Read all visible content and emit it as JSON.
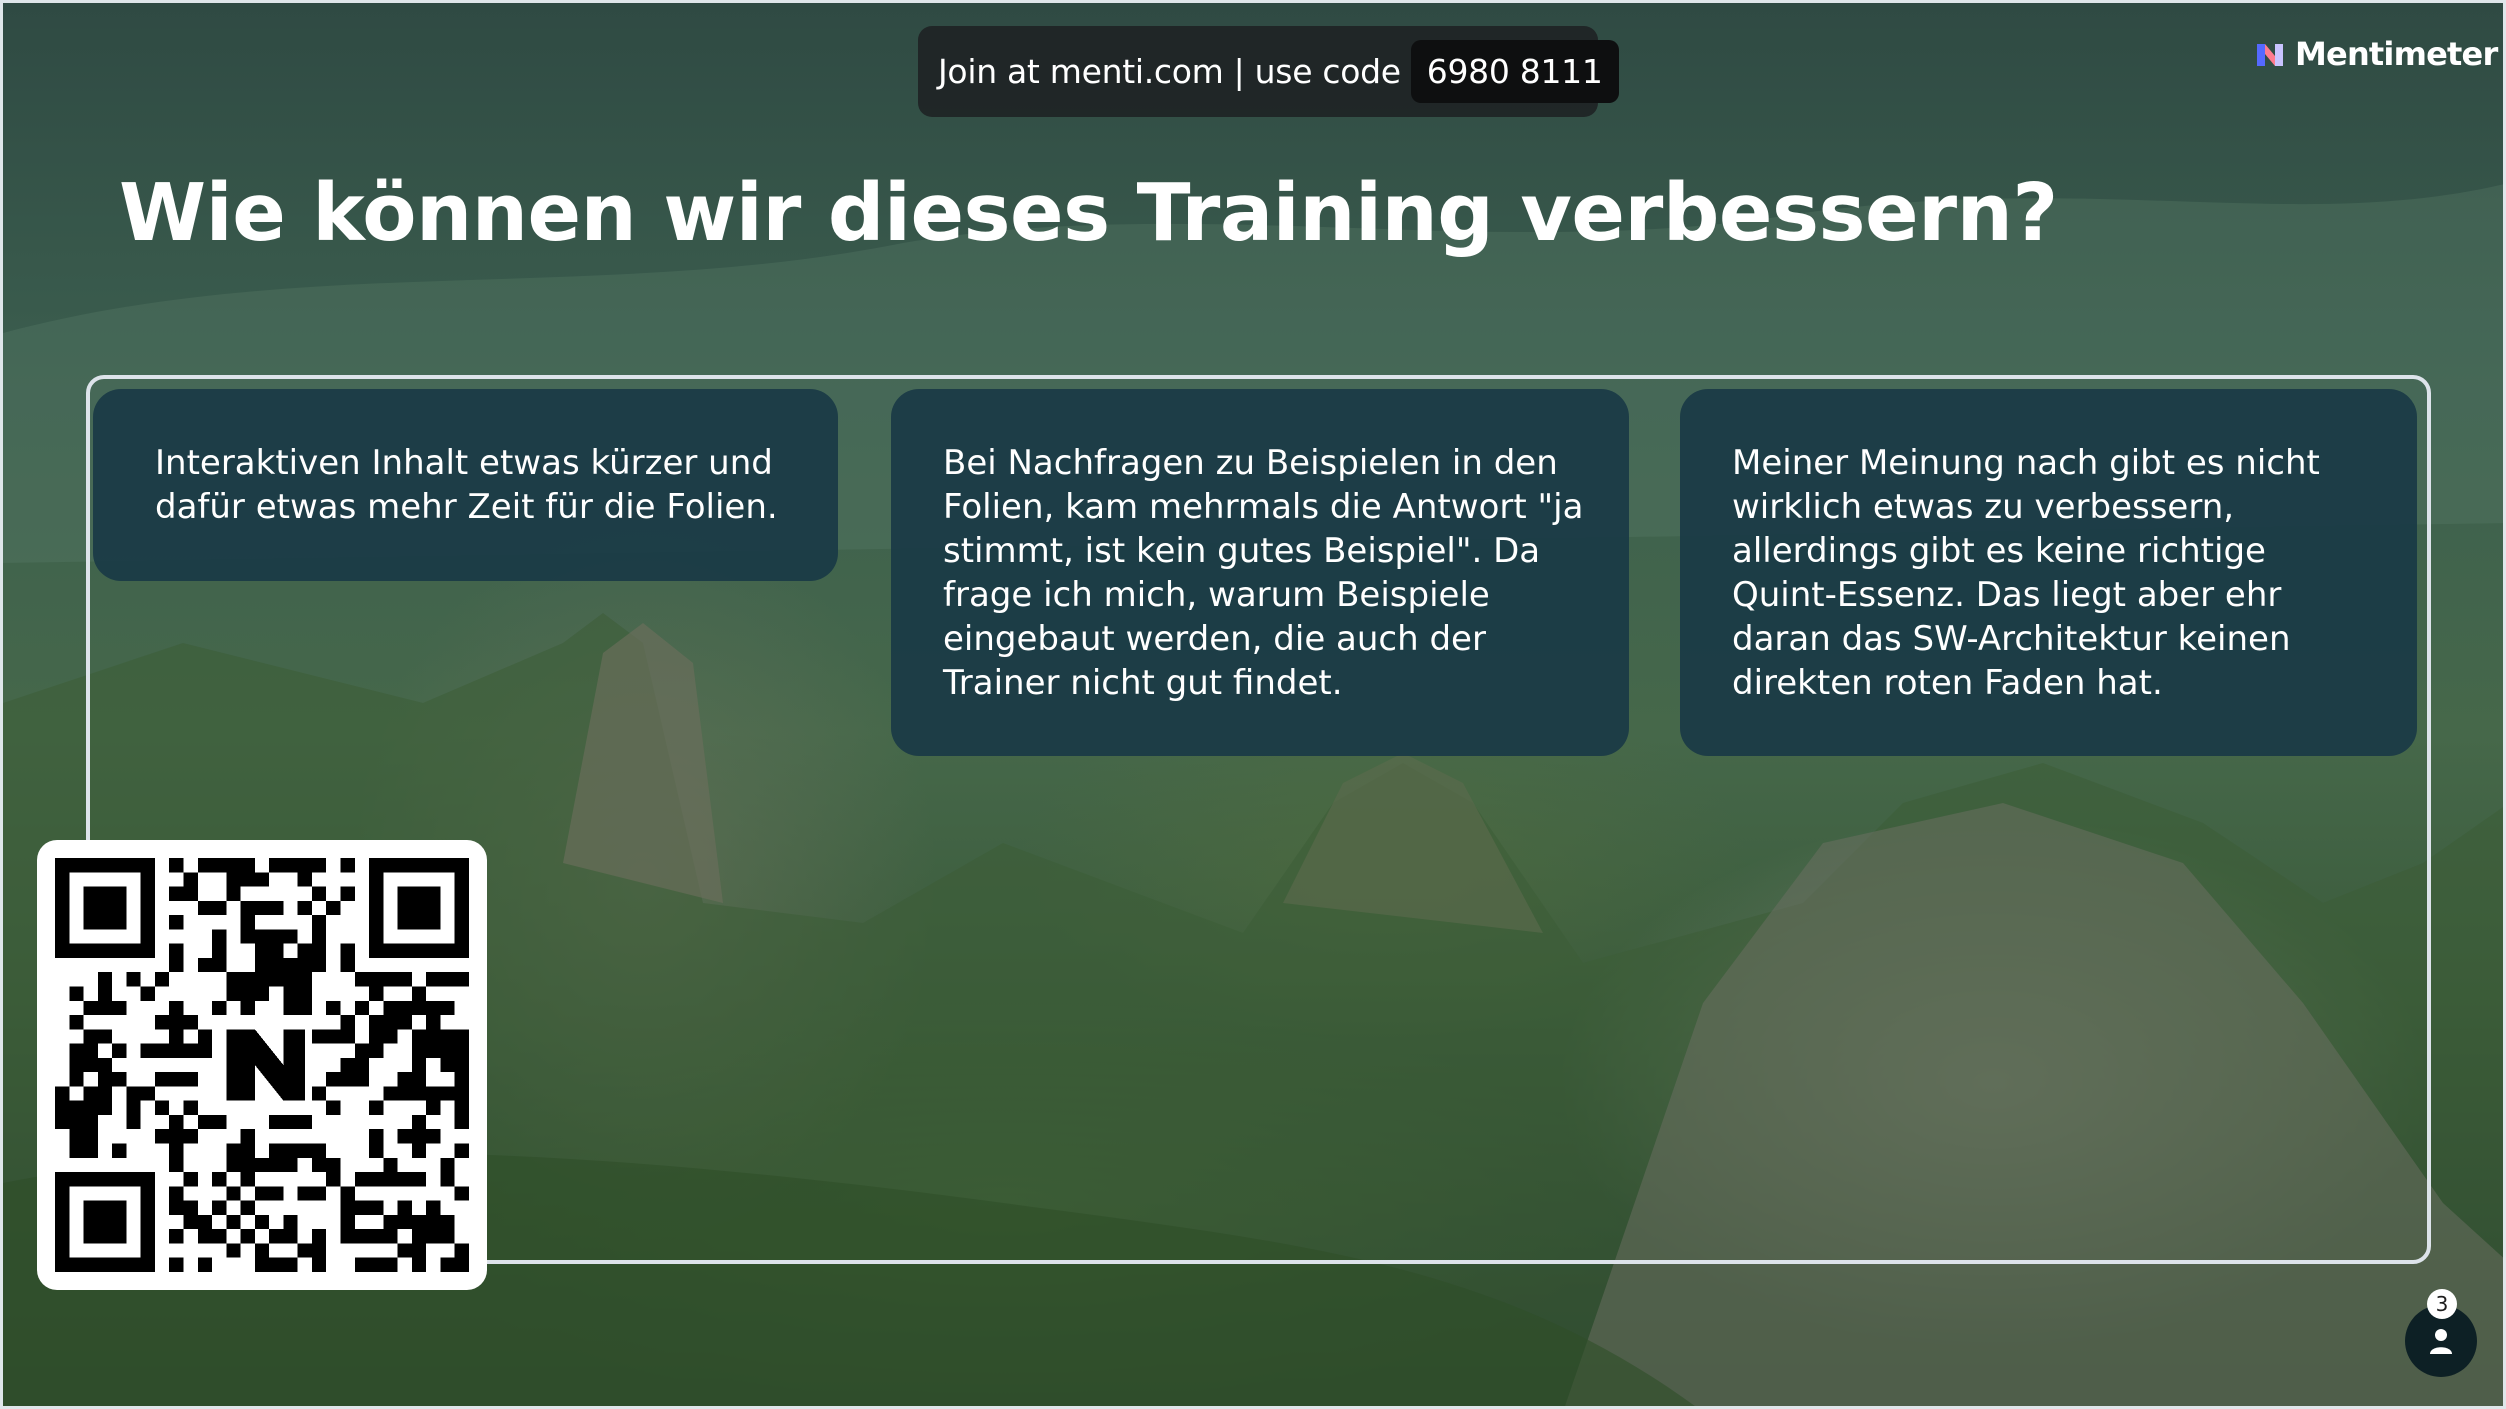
{
  "header": {
    "join_text": "Join at menti.com | use code",
    "join_code": "6980 8111",
    "brand_name": "Mentimeter"
  },
  "slide": {
    "question": "Wie können wir dieses Training verbessern?"
  },
  "responses": [
    {
      "text": "Interaktiven Inhalt etwas kürzer und dafür etwas mehr Zeit für die Folien."
    },
    {
      "text": "Bei Nachfragen zu Beispielen in den Folien, kam mehrmals die Antwort \"ja stimmt, ist kein gutes Beispiel\". Da frage ich mich, warum Beispiele eingebaut werden, die auch der Trainer nicht gut findet."
    },
    {
      "text": "Meiner Meinung nach gibt es nicht wirklich etwas zu verbessern, allerdings gibt es keine richtige Quint-Essenz. Das liegt aber ehr daran das SW-Architektur keinen direkten roten Faden hat."
    }
  ],
  "participants": {
    "count": "3"
  },
  "icons": {
    "brand": "mentimeter-logo-icon",
    "qr": "qr-code-icon",
    "participants": "person-icon"
  },
  "colors": {
    "card_background": "#1a3a46",
    "join_bar": "#1e2123",
    "frame_border": "#dde3ea"
  }
}
